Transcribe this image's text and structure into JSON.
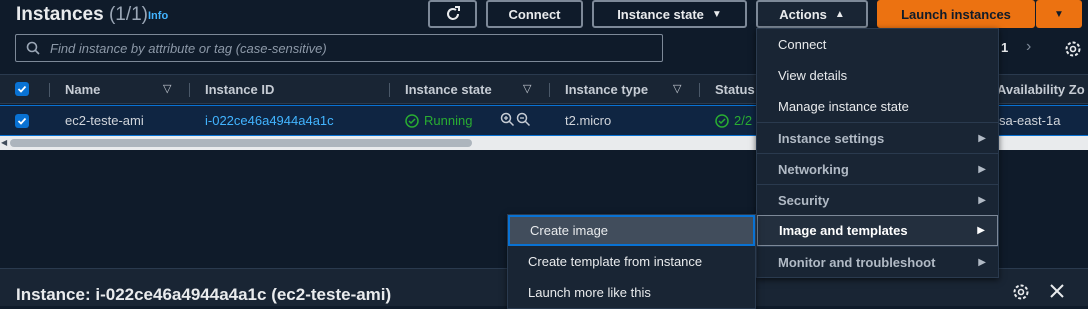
{
  "header": {
    "title": "Instances",
    "count": "(1/1)",
    "info": "Info",
    "refresh_icon": "refresh-icon",
    "connect": "Connect",
    "instance_state": "Instance state",
    "actions": "Actions",
    "launch": "Launch instances"
  },
  "search": {
    "placeholder": "Find instance by attribute or tag (case-sensitive)"
  },
  "pagination": {
    "page": "1"
  },
  "table": {
    "columns": [
      "Name",
      "Instance ID",
      "Instance state",
      "Instance type",
      "Status",
      "Availability Zo"
    ],
    "rows": [
      {
        "name": "ec2-teste-ami",
        "instance_id": "i-022ce46a4944a4a1c",
        "state": "Running",
        "type": "t2.micro",
        "status": "2/2",
        "az": "sa-east-1a"
      }
    ]
  },
  "actions_menu": {
    "items": [
      {
        "label": "Connect",
        "kind": "item"
      },
      {
        "label": "View details",
        "kind": "item"
      },
      {
        "label": "Manage instance state",
        "kind": "item"
      },
      {
        "label": "Instance settings",
        "kind": "submenu"
      },
      {
        "label": "Networking",
        "kind": "submenu"
      },
      {
        "label": "Security",
        "kind": "submenu"
      },
      {
        "label": "Image and templates",
        "kind": "submenu"
      },
      {
        "label": "Monitor and troubleshoot",
        "kind": "submenu"
      }
    ]
  },
  "image_submenu": {
    "items": [
      "Create image",
      "Create template from instance",
      "Launch more like this"
    ]
  },
  "detail_panel": {
    "title": "Instance: i-022ce46a4944a4a1c (ec2-teste-ami)"
  },
  "colors": {
    "accent": "#ec7211",
    "link": "#42b4ff",
    "success": "#29ad32",
    "selection": "#0972d3"
  }
}
